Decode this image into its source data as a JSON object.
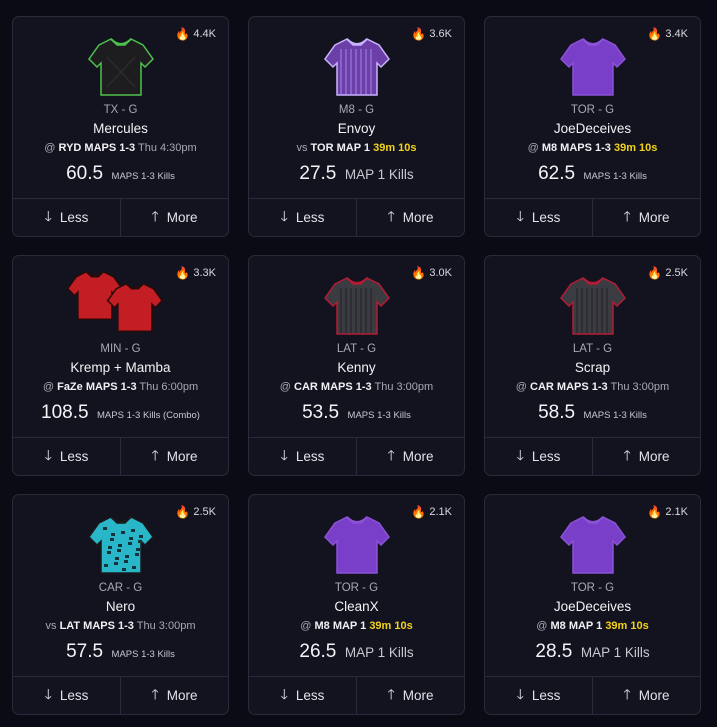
{
  "ui": {
    "less_label": "Less",
    "more_label": "More",
    "down_arrow": "🡓",
    "up_arrow": "🡑",
    "fire_glyph": "🔥"
  },
  "cards": [
    {
      "pop": "4.4K",
      "team": "TX - G",
      "player": "Mercules",
      "prefix": "@",
      "opp": "RYD MAPS 1-3",
      "when": "Thu 4:30pm",
      "timer": "",
      "value": "60.5",
      "stat": "MAPS 1-3 Kills",
      "big": false,
      "jersey": "black-green"
    },
    {
      "pop": "3.6K",
      "team": "M8 - G",
      "player": "Envoy",
      "prefix": "vs",
      "opp": "TOR MAP 1",
      "when": "",
      "timer": "39m 10s",
      "value": "27.5",
      "stat": "MAP 1 Kills",
      "big": true,
      "jersey": "purple-stripe"
    },
    {
      "pop": "3.4K",
      "team": "TOR - G",
      "player": "JoeDeceives",
      "prefix": "@",
      "opp": "M8 MAPS 1-3",
      "when": "",
      "timer": "39m 10s",
      "value": "62.5",
      "stat": "MAPS 1-3 Kills",
      "big": false,
      "jersey": "purple"
    },
    {
      "pop": "3.3K",
      "team": "MIN - G",
      "player": "Kremp + Mamba",
      "prefix": "@",
      "opp": "FaZe MAPS 1-3",
      "when": "Thu 6:00pm",
      "timer": "",
      "value": "108.5",
      "stat": "MAPS 1-3 Kills (Combo)",
      "big": false,
      "jersey": "red-double"
    },
    {
      "pop": "3.0K",
      "team": "LAT - G",
      "player": "Kenny",
      "prefix": "@",
      "opp": "CAR MAPS 1-3",
      "when": "Thu 3:00pm",
      "timer": "",
      "value": "53.5",
      "stat": "MAPS 1-3 Kills",
      "big": false,
      "jersey": "grey-stripe"
    },
    {
      "pop": "2.5K",
      "team": "LAT - G",
      "player": "Scrap",
      "prefix": "@",
      "opp": "CAR MAPS 1-3",
      "when": "Thu 3:00pm",
      "timer": "",
      "value": "58.5",
      "stat": "MAPS 1-3 Kills",
      "big": false,
      "jersey": "grey-stripe"
    },
    {
      "pop": "2.5K",
      "team": "CAR - G",
      "player": "Nero",
      "prefix": "vs",
      "opp": "LAT MAPS 1-3",
      "when": "Thu 3:00pm",
      "timer": "",
      "value": "57.5",
      "stat": "MAPS 1-3 Kills",
      "big": false,
      "jersey": "cyan-camo"
    },
    {
      "pop": "2.1K",
      "team": "TOR - G",
      "player": "CleanX",
      "prefix": "@",
      "opp": "M8 MAP 1",
      "when": "",
      "timer": "39m 10s",
      "value": "26.5",
      "stat": "MAP 1 Kills",
      "big": true,
      "jersey": "purple"
    },
    {
      "pop": "2.1K",
      "team": "TOR - G",
      "player": "JoeDeceives",
      "prefix": "@",
      "opp": "M8 MAP 1",
      "when": "",
      "timer": "39m 10s",
      "value": "28.5",
      "stat": "MAP 1 Kills",
      "big": true,
      "jersey": "purple"
    }
  ],
  "colors": {
    "black-green": [
      "#1d1d1f",
      "#4cc24c"
    ],
    "purple-stripe": [
      "#6c3fa8",
      "#c9b3ff"
    ],
    "purple": [
      "#7a3fc8",
      "#8b52d6"
    ],
    "red-double": [
      "#c31e24",
      "#2a0a0a"
    ],
    "grey-stripe": [
      "#3b3b42",
      "#b31d34"
    ],
    "cyan-camo": [
      "#2ab6c9",
      "#1a1a1a"
    ]
  }
}
